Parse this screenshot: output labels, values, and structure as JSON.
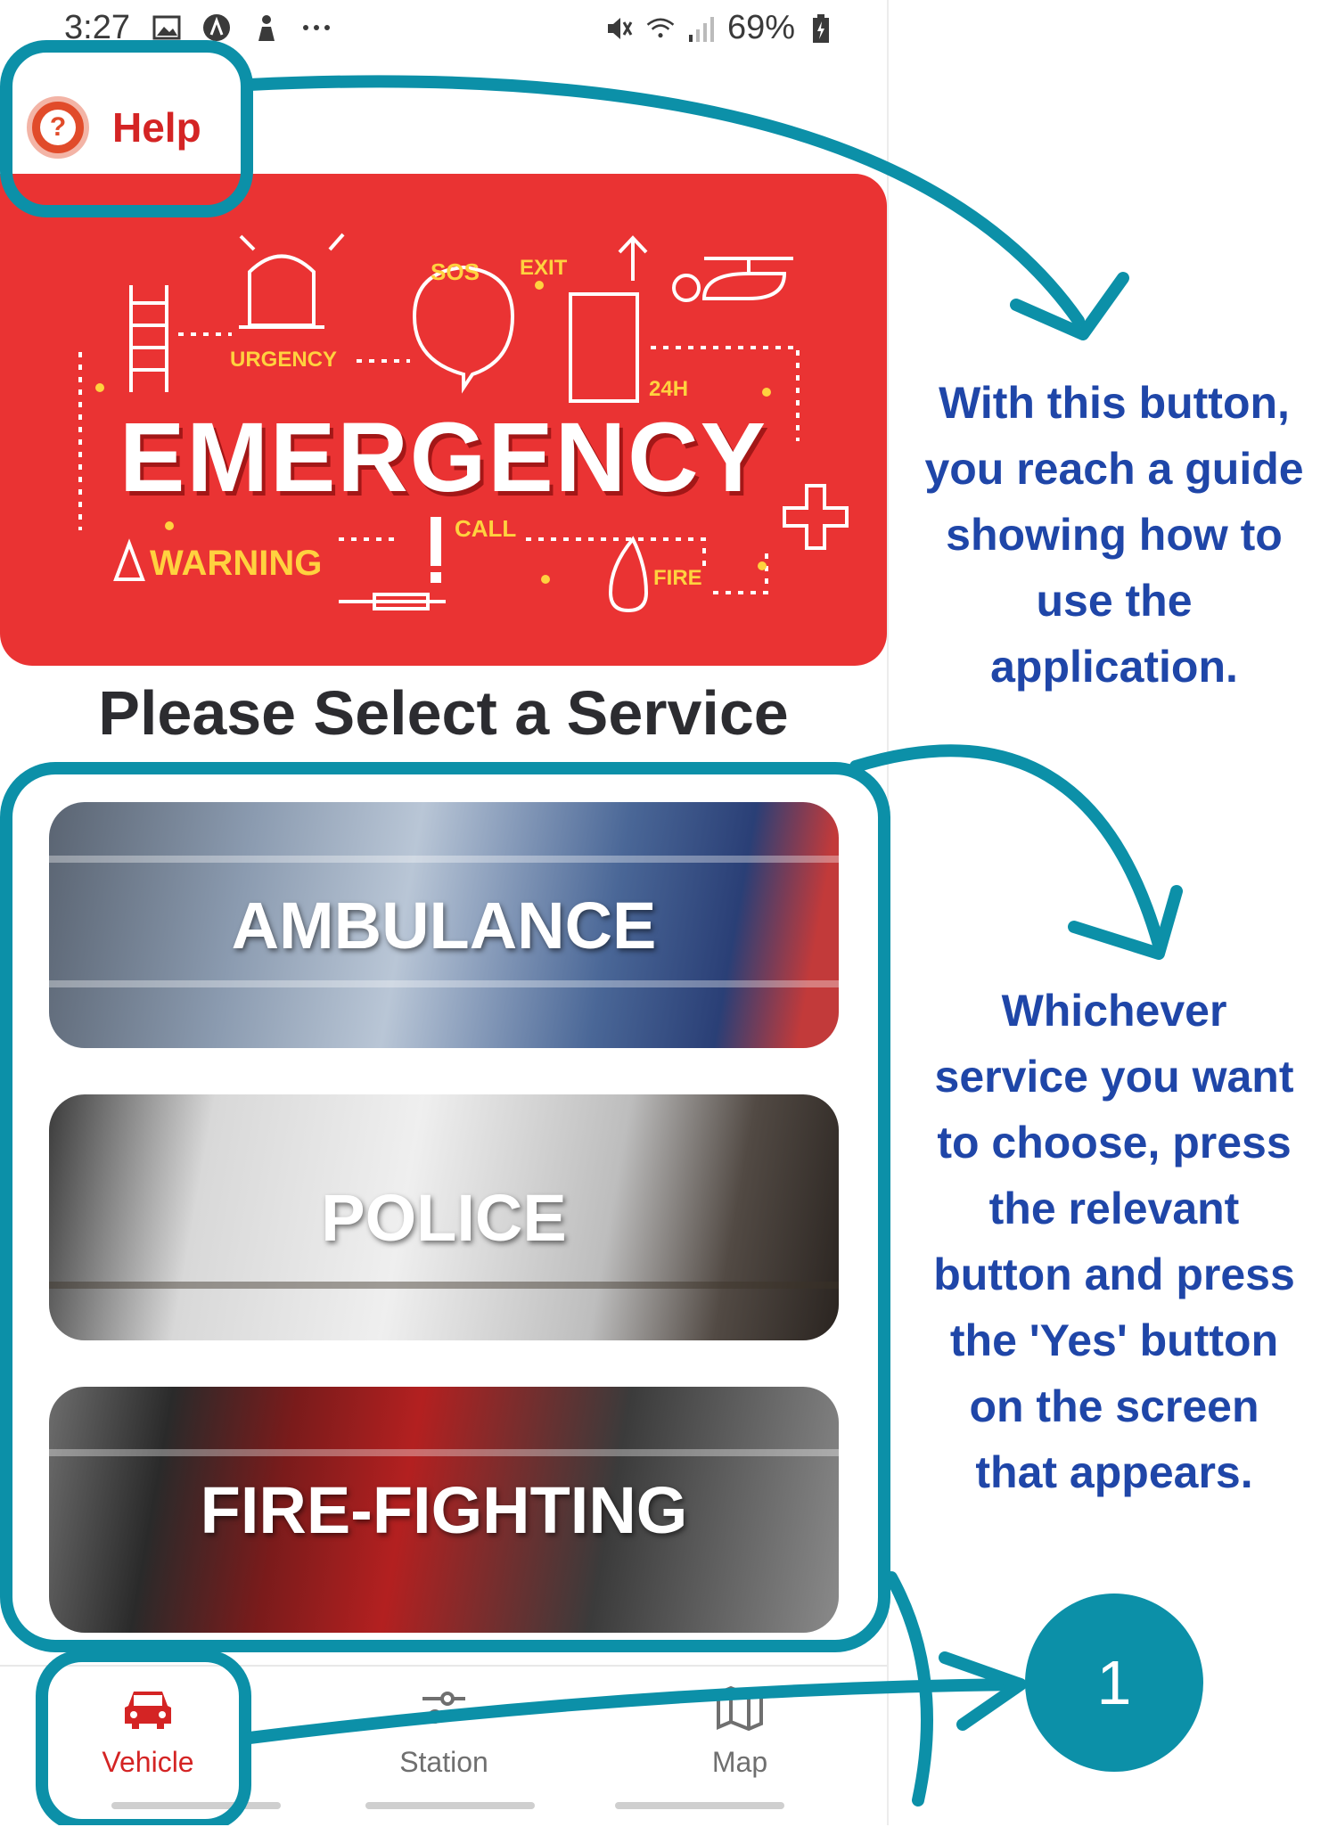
{
  "status_bar": {
    "time": "3:27",
    "battery": "69%",
    "icons_left": [
      "image-icon",
      "a-icon",
      "person-icon",
      "more-dots-icon"
    ],
    "icons_right": [
      "mute-icon",
      "wifi-icon",
      "signal-icon",
      "battery-icon"
    ]
  },
  "help": {
    "label": "Help",
    "icon": "question-icon"
  },
  "banner": {
    "title": "EMERGENCY",
    "words": {
      "sos": "SOS",
      "exit": "EXIT",
      "urgency": "URGENCY",
      "h24": "24H",
      "call": "CALL",
      "warning": "WARNING",
      "fire": "FIRE"
    }
  },
  "main": {
    "title": "Please Select a Service",
    "services": [
      {
        "label": "AMBULANCE"
      },
      {
        "label": "POLICE"
      },
      {
        "label": "FIRE-FIGHTING"
      }
    ]
  },
  "bottom_nav": {
    "items": [
      {
        "label": "Vehicle",
        "icon": "car-icon",
        "active": true
      },
      {
        "label": "Station",
        "icon": "station-icon",
        "active": false
      },
      {
        "label": "Map",
        "icon": "map-icon",
        "active": false
      }
    ]
  },
  "annotations": {
    "help_note_lines": [
      "With this button,",
      "you reach a guide",
      "showing how to",
      "use the",
      "application."
    ],
    "service_note_lines": [
      "Whichever",
      "service you want",
      "to choose, press",
      "the relevant",
      "button and press",
      "the 'Yes' button",
      "on the screen",
      "that appears."
    ],
    "step_number": "1"
  },
  "colors": {
    "accent_red": "#d42424",
    "banner_red": "#ea3333",
    "annotation_teal": "#0c90a8",
    "annotation_blue": "#1f46a8"
  }
}
